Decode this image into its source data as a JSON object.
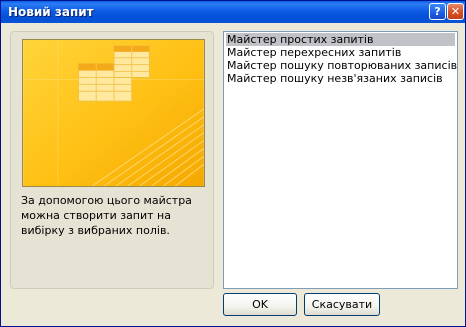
{
  "window": {
    "title": "Новий запит",
    "help_glyph": "?",
    "close_glyph": "✕"
  },
  "wizard": {
    "description": "За допомогою цього майстра можна створити запит на вибірку з вибраних полів.",
    "items": [
      {
        "label": "Майстер простих запитів",
        "selected": true
      },
      {
        "label": "Майстер перехресних запитів",
        "selected": false
      },
      {
        "label": "Майстер пошуку повторюваних записів",
        "selected": false
      },
      {
        "label": "Майстер пошуку незв'язаних записів",
        "selected": false
      }
    ]
  },
  "buttons": {
    "ok": "OK",
    "cancel": "Скасувати"
  },
  "colors": {
    "titlebar": "#0a5de8",
    "dialog_bg": "#ece9d8",
    "illustration_bg": "#ffc21a",
    "selection": "#c1c1c8"
  }
}
